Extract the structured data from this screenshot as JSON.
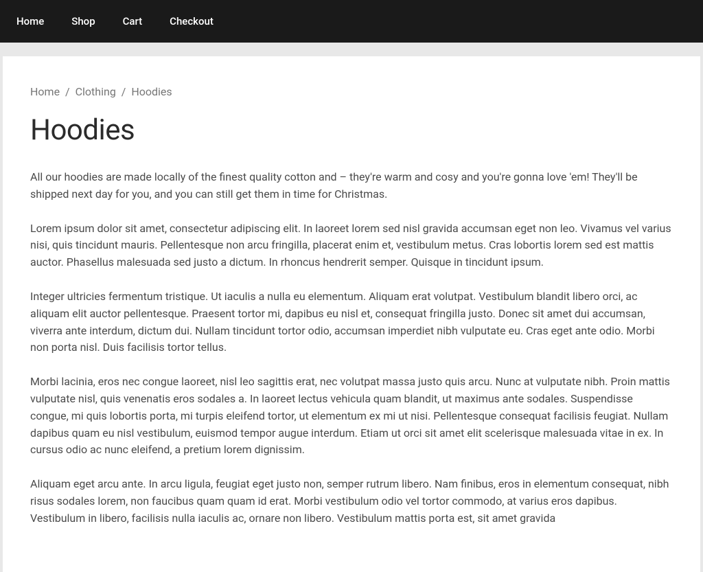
{
  "nav": {
    "items": [
      {
        "label": "Home"
      },
      {
        "label": "Shop"
      },
      {
        "label": "Cart"
      },
      {
        "label": "Checkout"
      }
    ]
  },
  "breadcrumb": {
    "items": [
      {
        "label": "Home",
        "link": true
      },
      {
        "label": "Clothing",
        "link": true
      },
      {
        "label": "Hoodies",
        "link": false
      }
    ],
    "separator": "/"
  },
  "page": {
    "title": "Hoodies",
    "paragraphs": [
      "All our hoodies are made locally of the finest quality cotton and – they're warm and cosy and you're gonna love 'em! They'll be shipped next day for you, and you can still get them in time for Christmas.",
      "Lorem ipsum dolor sit amet, consectetur adipiscing elit. In laoreet lorem sed nisl gravida accumsan eget non leo. Vivamus vel varius nisi, quis tincidunt mauris. Pellentesque non arcu fringilla, placerat enim et, vestibulum metus. Cras lobortis lorem sed est mattis auctor. Phasellus malesuada sed justo a dictum. In rhoncus hendrerit semper. Quisque in tincidunt ipsum.",
      "Integer ultricies fermentum tristique. Ut iaculis a nulla eu elementum. Aliquam erat volutpat. Vestibulum blandit libero orci, ac aliquam elit auctor pellentesque. Praesent tortor mi, dapibus eu nisl et, consequat fringilla justo. Donec sit amet dui accumsan, viverra ante interdum, dictum dui. Nullam tincidunt tortor odio, accumsan imperdiet nibh vulputate eu. Cras eget ante odio. Morbi non porta nisl. Duis facilisis tortor tellus.",
      "Morbi lacinia, eros nec congue laoreet, nisl leo sagittis erat, nec volutpat massa justo quis arcu. Nunc at vulputate nibh. Proin mattis vulputate nisl, quis venenatis eros sodales a. In laoreet lectus vehicula quam blandit, ut maximus ante sodales. Suspendisse congue, mi quis lobortis porta, mi turpis eleifend tortor, ut elementum ex mi ut nisi. Pellentesque consequat facilisis feugiat. Nullam dapibus quam eu nisl vestibulum, euismod tempor augue interdum. Etiam ut orci sit amet elit scelerisque malesuada vitae in ex. In cursus odio ac nunc eleifend, a pretium lorem dignissim.",
      "Aliquam eget arcu ante. In arcu ligula, feugiat eget justo non, semper rutrum libero. Nam finibus, eros in elementum consequat, nibh risus sodales lorem, non faucibus quam quam id erat. Morbi vestibulum odio vel tortor commodo, at varius eros dapibus. Vestibulum in libero, facilisis nulla iaculis ac, ornare non libero. Vestibulum mattis porta est, sit amet gravida"
    ]
  }
}
